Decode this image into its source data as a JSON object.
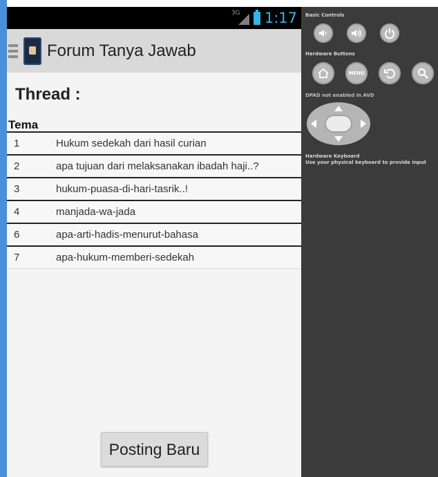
{
  "status": {
    "network": "3G",
    "time": "1:17",
    "accent": "#33b5e5"
  },
  "appbar": {
    "title": "Forum Tanya Jawab",
    "icon": "quran-book-icon"
  },
  "thread": {
    "heading": "Thread :",
    "column_header": "Tema",
    "rows": [
      {
        "no": "1",
        "topic": "Hukum sedekah dari hasil curian"
      },
      {
        "no": "2",
        "topic": "apa tujuan dari melaksanakan ibadah haji..?"
      },
      {
        "no": "3",
        "topic": "hukum-puasa-di-hari-tasrik..!"
      },
      {
        "no": "4",
        "topic": "manjada-wa-jada"
      },
      {
        "no": "6",
        "topic": "apa-arti-hadis-menurut-bahasa"
      },
      {
        "no": "7",
        "topic": "apa-hukum-memberi-sedekah"
      }
    ]
  },
  "actions": {
    "post_button": "Posting Baru"
  },
  "emulator": {
    "basic_controls": "Basic Controls",
    "hardware_buttons": "Hardware Buttons",
    "menu_label": "MENU",
    "dpad_note": "DPAD not enabled in AVD",
    "keyboard_title": "Hardware Keyboard",
    "keyboard_note": "Use your physical keyboard to provide input"
  }
}
